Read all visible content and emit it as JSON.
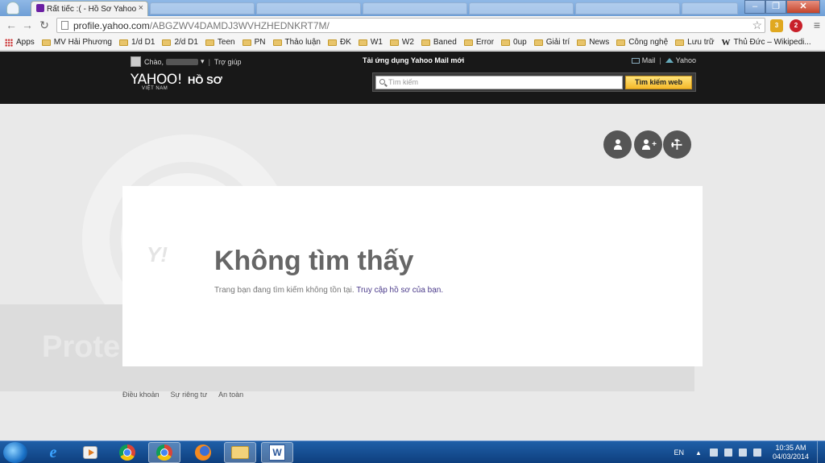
{
  "browser": {
    "tab_title": "Rất tiếc :( - Hồ Sơ Yahoo",
    "url_host": "profile.yahoo.com",
    "url_path": "/ABGZWV4DAMDJ3WVHZHEDNKRT7M/",
    "extensions": [
      {
        "name": "notifier-extension",
        "badge": "3",
        "color": "#e0a820"
      },
      {
        "name": "adblock-plus-extension",
        "badge": "2",
        "color": "#c8202a"
      }
    ],
    "bookmarks": [
      {
        "label": "Apps",
        "kind": "apps"
      },
      {
        "label": "MV Hải Phương",
        "kind": "folder"
      },
      {
        "label": "1/d D1",
        "kind": "folder"
      },
      {
        "label": "2/d D1",
        "kind": "folder"
      },
      {
        "label": "Teen",
        "kind": "folder"
      },
      {
        "label": "PN",
        "kind": "folder"
      },
      {
        "label": "Thảo luận",
        "kind": "folder"
      },
      {
        "label": "ĐK",
        "kind": "folder"
      },
      {
        "label": "W1",
        "kind": "folder"
      },
      {
        "label": "W2",
        "kind": "folder"
      },
      {
        "label": "Baned",
        "kind": "folder"
      },
      {
        "label": "Error",
        "kind": "folder"
      },
      {
        "label": "0up",
        "kind": "folder"
      },
      {
        "label": "Giải trí",
        "kind": "folder"
      },
      {
        "label": "News",
        "kind": "folder"
      },
      {
        "label": "Công nghệ",
        "kind": "folder"
      },
      {
        "label": "Lưu trữ",
        "kind": "folder"
      },
      {
        "label": "Thủ Đức – Wikipedi...",
        "kind": "wiki"
      }
    ]
  },
  "yahoo_header": {
    "greeting": "Chào,",
    "help_link": "Trợ giúp",
    "promo": "Tải ứng dụng Yahoo Mail mới",
    "mail_link": "Mail",
    "home_link": "Yahoo",
    "logo": "YAHOO!",
    "logo_sub": "VIỆT NAM",
    "section": "HỒ SƠ",
    "search_placeholder": "Tìm kiếm",
    "search_button": "Tìm kiếm web"
  },
  "main": {
    "title": "Không tìm thấy",
    "message": "Trang bạn đang tìm kiếm không tồn tại.",
    "profile_link": "Truy cập hồ sơ của bạn.",
    "watermark": "Prote",
    "card_logo": "Y!"
  },
  "footer": {
    "links": [
      "Điều khoản",
      "Sự riêng tư",
      "An toàn"
    ]
  },
  "taskbar": {
    "language": "EN",
    "time": "10:35 AM",
    "date": "04/03/2014"
  }
}
